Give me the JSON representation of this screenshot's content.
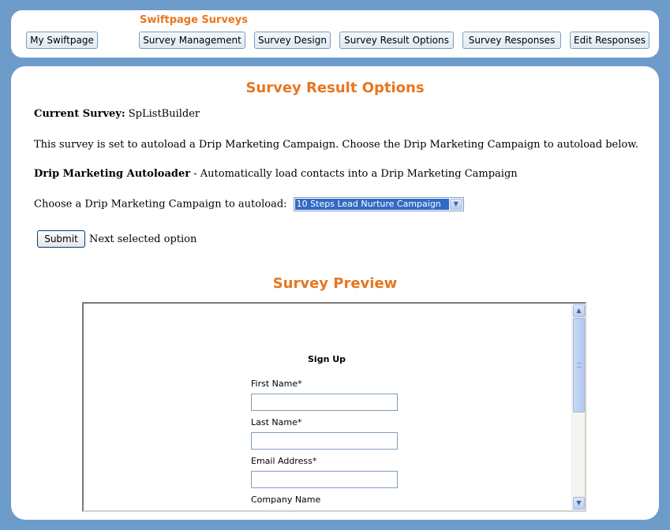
{
  "header": {
    "brand": "Swiftpage Surveys",
    "my_swiftpage": "My Swiftpage",
    "nav": [
      "Survey Management",
      "Survey Design",
      "Survey Result Options",
      "Survey Responses",
      "Edit Responses"
    ]
  },
  "main": {
    "title": "Survey Result Options",
    "current_survey_label": "Current Survey:",
    "current_survey_value": "SpListBuilder",
    "autoload_note": "This survey is set to autoload a Drip Marketing Campaign. Choose the Drip Marketing Campaign to autoload below.",
    "autoloader_label": "Drip Marketing Autoloader",
    "autoloader_desc": " - Automatically load contacts into a Drip Marketing Campaign",
    "choose_label": "Choose a Drip Marketing Campaign to autoload:",
    "selected_campaign": "10 Steps Lead Nurture Campaign",
    "submit_label": "Submit",
    "next_text": "Next selected option"
  },
  "preview": {
    "title": "Survey Preview",
    "form_title": "Sign Up",
    "fields": [
      {
        "label": "First Name*"
      },
      {
        "label": "Last Name*"
      },
      {
        "label": "Email Address*"
      },
      {
        "label": "Company Name"
      }
    ]
  },
  "colors": {
    "background": "#6d9ccb",
    "accent": "#e8761e",
    "selection": "#316ac5"
  },
  "icons": {
    "dropdown": "chevron-down-icon",
    "scroll_up": "arrow-up-icon",
    "scroll_down": "arrow-down-icon"
  }
}
